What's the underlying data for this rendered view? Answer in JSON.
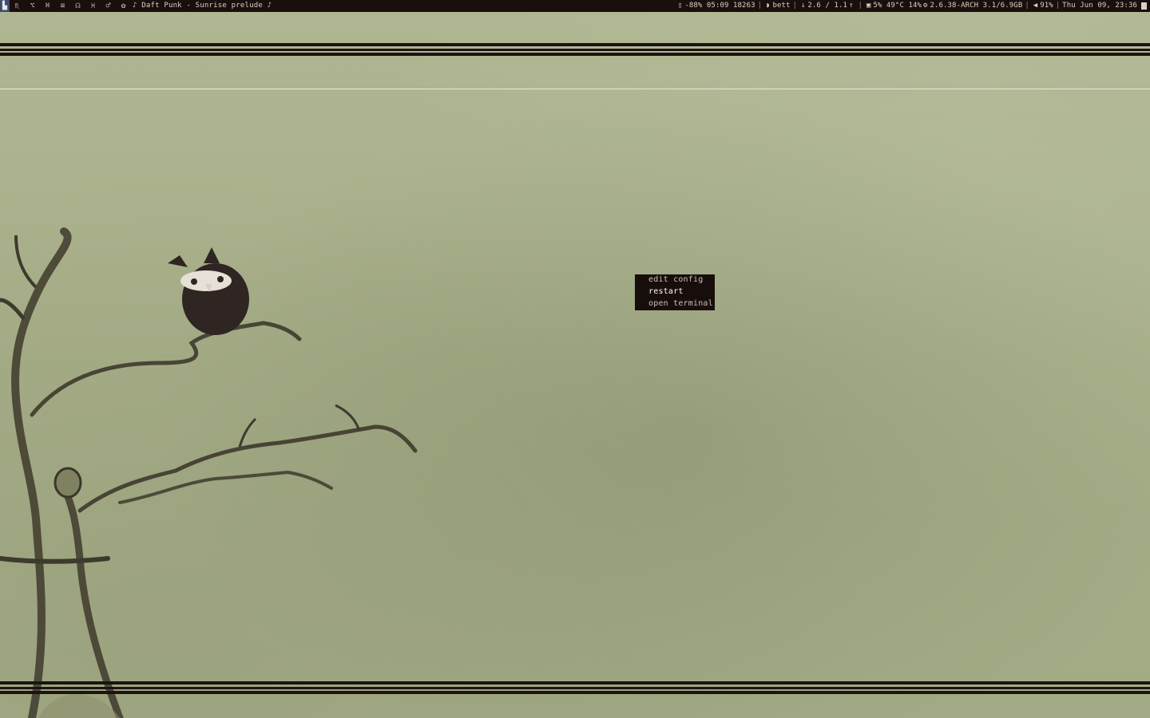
{
  "statusbar": {
    "tag_icons": [
      {
        "icon": "terminal-tag-icon",
        "glyph": "▙",
        "active": true
      },
      {
        "icon": "scorpio-tag-icon",
        "glyph": "♏",
        "active": false
      },
      {
        "icon": "option-tag-icon",
        "glyph": "⌥",
        "active": false
      },
      {
        "icon": "command-tag-icon",
        "glyph": "⌘",
        "active": false
      },
      {
        "icon": "equals-tag-icon",
        "glyph": "≡",
        "active": false
      },
      {
        "icon": "headphones-tag-icon",
        "glyph": "☊",
        "active": false
      },
      {
        "icon": "pisces-tag-icon",
        "glyph": "♓",
        "active": false
      },
      {
        "icon": "mars-tag-icon",
        "glyph": "♂",
        "active": false
      },
      {
        "icon": "flower-tag-icon",
        "glyph": "✿",
        "active": false
      }
    ],
    "now_playing": "♪ Daft Punk - Sunrise prelude ♪",
    "battery": "-88% 05:09 18263",
    "wifi": "bett",
    "net_down": "2.6",
    "net_up": "1.1",
    "cpu": "5% 49°C 14%",
    "kernel": "2.6.38-ARCH 3.1/6.9GB",
    "volume": "91%",
    "datetime": "Thu Jun 09, 23:36"
  },
  "context_menu": {
    "items": [
      {
        "label": "edit config",
        "highlighted": false
      },
      {
        "label": "restart",
        "highlighted": true
      },
      {
        "label": "open terminal",
        "highlighted": false
      }
    ]
  },
  "colors": {
    "bar_bg": "#1a0f0d",
    "bar_fg": "#d8d2c4",
    "active_tag": "#3d4c6c",
    "wallpaper": "#a7b08a",
    "menu_bg": "#170d0b"
  }
}
